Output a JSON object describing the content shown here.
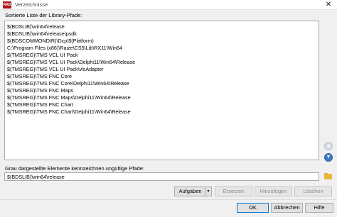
{
  "window": {
    "title": "Verzeichnisse",
    "app_icon_text": "RAD",
    "close_glyph": "✕"
  },
  "list": {
    "label": "Sortierte Liste der Library-Pfade:",
    "items": [
      "$(BDSLIB)\\win64\\release",
      "$(BDSLIB)\\win64\\release\\psdk",
      "$(BDSCOMMONDIR)\\Dcp\\$(Platform)",
      "C:\\Program Files (x86)\\Raize\\CS5\\Lib\\RX11\\Win64",
      "$(TMSREG)\\TMS VCL UI Pack",
      "$(TMSREG)\\TMS VCL UI Pack\\Delphi11\\Win64\\Release",
      "$(TMSREG)\\TMS VCL UI Pack\\vlsAdapter",
      "$(TMSREG)\\TMS FNC Core",
      "$(TMSREG)\\TMS FNC Core\\Delphi11\\Win64\\Release",
      "$(TMSREG)\\TMS FNC Maps",
      "$(TMSREG)\\TMS FNC Maps\\Delphi11\\Win64\\Release",
      "$(TMSREG)\\TMS FNC Chart",
      "$(TMSREG)\\TMS FNC Chart\\Delphi11\\Win64\\Release"
    ]
  },
  "side_buttons": {
    "up_icon": "arrow-up-icon",
    "down_icon": "arrow-down-icon",
    "up_glyph": "▲",
    "down_glyph": "▼"
  },
  "invalid_note": "Grau dargestellte Elemente kennzeichnen ungültige Pfade:",
  "path_input": {
    "value": "$(BDSLIB)\\win64\\release",
    "browse_icon": "folder-icon"
  },
  "action_buttons": {
    "tasks": "Aufgaben",
    "tasks_arrow": "▼",
    "replace": "Ersetzen",
    "add": "Hinzufügen",
    "delete": "Löschen"
  },
  "dialog_buttons": {
    "ok": "OK",
    "cancel": "Abbrechen",
    "help": "Hilfe"
  },
  "colors": {
    "accent": "#0078d7",
    "disabled_text": "#8a8a8a"
  }
}
